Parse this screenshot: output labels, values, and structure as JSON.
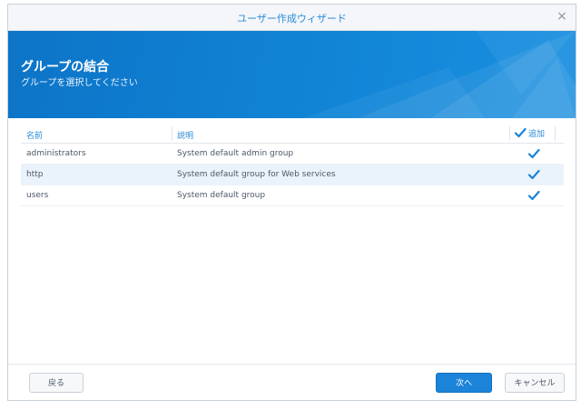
{
  "window": {
    "title": "ユーザー作成ウィザード",
    "close_glyph": "×"
  },
  "banner": {
    "title": "グループの結合",
    "subtitle": "グループを選択してください"
  },
  "grid": {
    "headers": {
      "name": "名前",
      "description": "説明",
      "add": "追加"
    },
    "add_all_checked": true,
    "rows": [
      {
        "name": "administrators",
        "description": "System default admin group",
        "checked": true
      },
      {
        "name": "http",
        "description": "System default group for Web services",
        "checked": true
      },
      {
        "name": "users",
        "description": "System default group",
        "checked": true
      }
    ]
  },
  "footer": {
    "back_label": "戻る",
    "next_label": "次へ",
    "cancel_label": "キャンセル"
  },
  "colors": {
    "accent": "#1b83d8",
    "banner": "#1184d6",
    "highlight_row": "#eaf3fc"
  }
}
